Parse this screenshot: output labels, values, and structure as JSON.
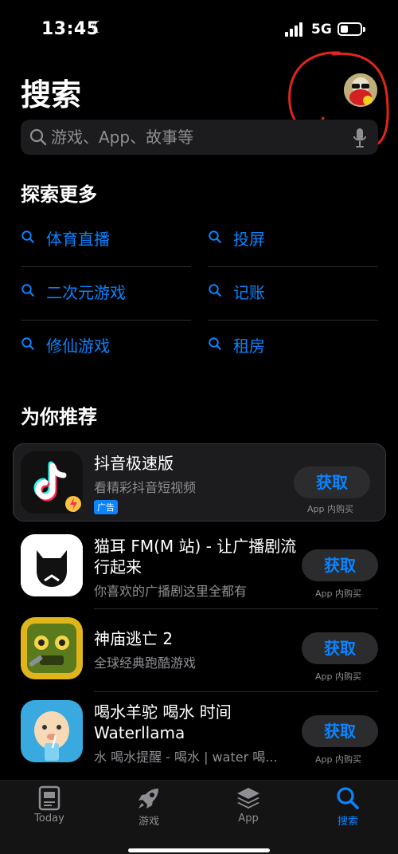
{
  "status": {
    "time": "13:45",
    "network": "5G"
  },
  "header": {
    "title": "搜索"
  },
  "search": {
    "placeholder": "游戏、App、故事等"
  },
  "explore": {
    "title": "探索更多",
    "items": [
      "体育直播",
      "投屏",
      "二次元游戏",
      "记账",
      "修仙游戏",
      "租房"
    ]
  },
  "recommend": {
    "title": "为你推荐",
    "apps": [
      {
        "name": "抖音极速版",
        "subtitle": "看精彩抖音短视频",
        "badge": "广告",
        "button": "获取",
        "note": "App 内购买"
      },
      {
        "name": "猫耳 FM(M 站) - 让广播剧流行起来",
        "subtitle": "你喜欢的广播剧这里全都有",
        "button": "获取",
        "note": "App 内购买"
      },
      {
        "name": "神庙逃亡 2",
        "subtitle": "全球经典跑酷游戏",
        "button": "获取",
        "note": "App 内购买"
      },
      {
        "name": "喝水羊驼 喝水 时间 Waterllama",
        "subtitle": "水 喝水提醒 - 喝水 | water 喝...",
        "button": "获取",
        "note": "App 内购买"
      }
    ]
  },
  "tabs": [
    {
      "label": "Today",
      "icon": "today-icon"
    },
    {
      "label": "游戏",
      "icon": "rocket-icon"
    },
    {
      "label": "App",
      "icon": "app-stack-icon"
    },
    {
      "label": "搜索",
      "icon": "search-icon",
      "active": true
    }
  ],
  "colors": {
    "accent": "#0a84ff",
    "annotation": "#e0261b",
    "background": "#000000"
  }
}
